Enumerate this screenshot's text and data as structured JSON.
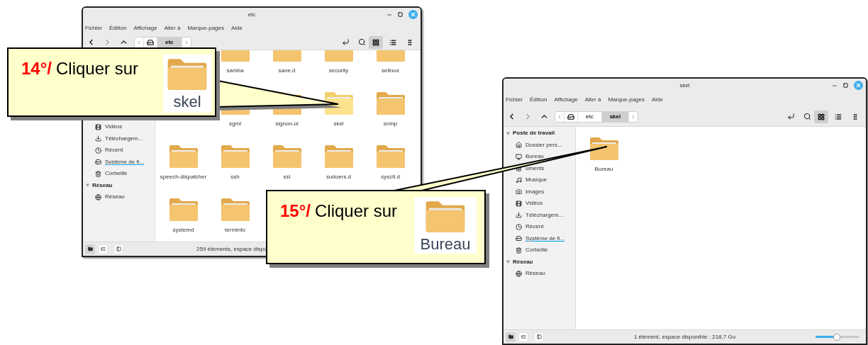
{
  "windows": [
    {
      "title": "etc",
      "menu": [
        "Fichier",
        "Édition",
        "Affichage",
        "Aller à",
        "Marque-pages",
        "Aide"
      ],
      "path": [
        {
          "label": "etc",
          "selected": true
        }
      ],
      "view_modes": [
        {
          "kind": "grid",
          "selected": true
        },
        {
          "kind": "list",
          "selected": false
        },
        {
          "kind": "compact",
          "selected": false
        }
      ],
      "sidebar": [
        {
          "kind": "covered"
        },
        {
          "kind": "covered"
        },
        {
          "kind": "covered"
        },
        {
          "kind": "covered"
        },
        {
          "kind": "covered"
        },
        {
          "kind": "covered"
        },
        {
          "kind": "videos",
          "label": "Vidéos"
        },
        {
          "kind": "downloads",
          "label": "Téléchargem..."
        },
        {
          "kind": "recent",
          "label": "Récent"
        },
        {
          "kind": "filesystem",
          "label": "Système de fi..."
        },
        {
          "kind": "trash",
          "label": "Corbeille"
        },
        {
          "kind": "header",
          "label": "Réseau"
        },
        {
          "kind": "network",
          "label": "Réseau"
        }
      ],
      "folders": [
        {
          "kind": "covered"
        },
        {
          "kind": "folder",
          "label": "samba",
          "selected": false
        },
        {
          "kind": "folder",
          "label": "sane.d",
          "selected": false
        },
        {
          "kind": "folder",
          "label": "security",
          "selected": false
        },
        {
          "kind": "folder",
          "label": "selinux",
          "selected": false
        },
        {
          "kind": "covered"
        },
        {
          "kind": "folder",
          "label": "sgml",
          "selected": false
        },
        {
          "kind": "folder",
          "label": "signon-ui",
          "selected": false
        },
        {
          "kind": "folder",
          "label": "skel",
          "selected": true
        },
        {
          "kind": "folder",
          "label": "snmp",
          "selected": false
        },
        {
          "kind": "folder",
          "label": "speech-dispatcher",
          "selected": false
        },
        {
          "kind": "folder",
          "label": "ssh",
          "selected": false
        },
        {
          "kind": "folder",
          "label": "ssl",
          "selected": false
        },
        {
          "kind": "folder",
          "label": "sudoers.d",
          "selected": false
        },
        {
          "kind": "folder",
          "label": "sysctl.d",
          "selected": false
        },
        {
          "kind": "folder",
          "label": "systemd",
          "selected": false
        },
        {
          "kind": "folder",
          "label": "terminfo",
          "selected": false
        }
      ],
      "status": "259 éléments, espace dispo"
    },
    {
      "title": "skel",
      "menu": [
        "Fichier",
        "Édition",
        "Affichage",
        "Aller à",
        "Marque-pages",
        "Aide"
      ],
      "path": [
        {
          "label": "etc",
          "selected": false
        },
        {
          "label": "skel",
          "selected": true
        }
      ],
      "view_modes": [
        {
          "kind": "grid",
          "selected": true
        },
        {
          "kind": "list",
          "selected": false
        },
        {
          "kind": "compact",
          "selected": false
        }
      ],
      "sidebar": [
        {
          "kind": "header",
          "label": "Poste de travail"
        },
        {
          "kind": "home",
          "label": "Dossier pers..."
        },
        {
          "kind": "desktop",
          "label": "Bureau"
        },
        {
          "kind": "documents",
          "label": "uments"
        },
        {
          "kind": "music",
          "label": "Musique"
        },
        {
          "kind": "images",
          "label": "Images"
        },
        {
          "kind": "videos",
          "label": "Vidéos"
        },
        {
          "kind": "downloads",
          "label": "Téléchargem..."
        },
        {
          "kind": "recent",
          "label": "Récent"
        },
        {
          "kind": "filesystem",
          "label": "Système de fi..."
        },
        {
          "kind": "trash",
          "label": "Corbeille"
        },
        {
          "kind": "header",
          "label": "Réseau"
        },
        {
          "kind": "network",
          "label": "Réseau"
        }
      ],
      "folders": [
        {
          "kind": "folder",
          "label": "Bureau",
          "selected": false
        }
      ],
      "status": "1 élément, espace disponible : 218,7 Go",
      "zoom": {
        "level": 0.48
      }
    }
  ],
  "callouts": [
    {
      "step": "14°/",
      "text": "Cliquer sur",
      "target": "skel"
    },
    {
      "step": "15°/",
      "text": "Cliquer sur",
      "target": "Bureau"
    }
  ]
}
